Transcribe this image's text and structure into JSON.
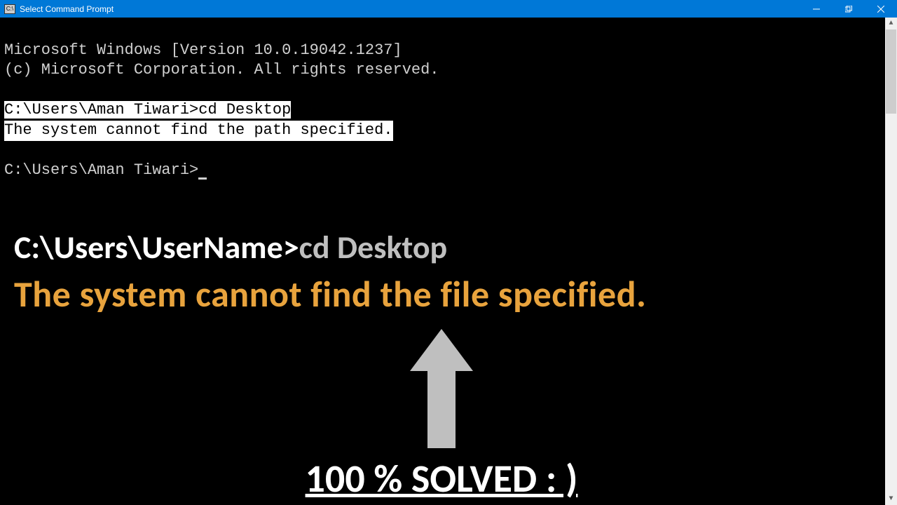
{
  "titlebar": {
    "icon_text": "C:\\",
    "title": "Select Command Prompt"
  },
  "terminal": {
    "line1": "Microsoft Windows [Version 10.0.19042.1237]",
    "line2": "(c) Microsoft Corporation. All rights reserved.",
    "prompt1": "C:\\Users\\Aman Tiwari>",
    "cmd1": "cd Desktop",
    "error1": "The system cannot find the path specified.",
    "prompt2": "C:\\Users\\Aman Tiwari>"
  },
  "overlay": {
    "cmd_prompt": "C:\\Users\\UserName>",
    "cmd_text": "cd Desktop",
    "error_text": "The system cannot find the file specified.",
    "solved_text": "100 % SOLVED : )"
  }
}
